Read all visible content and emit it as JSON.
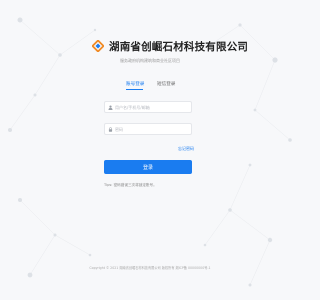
{
  "brand": {
    "company_name": "湖南省创崛石材科技有限公司",
    "tagline": "服务政府机构建筑和商业社区项目"
  },
  "tabs": [
    {
      "label": "账号登录",
      "active": true
    },
    {
      "label": "短信登录",
      "active": false
    }
  ],
  "form": {
    "account_placeholder": "用户名/手机号/邮箱",
    "password_placeholder": "密码",
    "forgot_label": "忘记密码",
    "login_label": "登录",
    "tips": "Tips: 密码错误三次将锁定账号。"
  },
  "footer": {
    "copyright": "Copyright © 2021 湖南省创崛石材科技有限公司 版权所有  湘ICP备 00000000号-1"
  },
  "colors": {
    "accent": "#1a7cf0",
    "logo_orange": "#f08a24",
    "logo_blue": "#1a7cf0",
    "background": "#f7f8fa"
  },
  "icons": {
    "logo": "brand-logo-icon",
    "account": "user-icon",
    "password": "lock-icon"
  }
}
